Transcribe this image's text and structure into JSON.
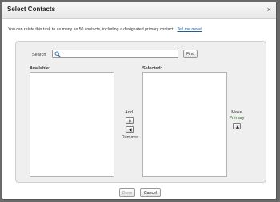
{
  "dialog": {
    "title": "Select Contacts",
    "close_glyph": "×",
    "intro_text": "You can relate this task to as many as 50 contacts, including a designated primary contact.",
    "tell_me_more": "Tell me more!"
  },
  "search": {
    "label": "Search",
    "value": "",
    "find_label": "Find",
    "icon": "search-icon"
  },
  "available": {
    "label": "Available:",
    "items": []
  },
  "selected": {
    "label": "Selected:",
    "items": []
  },
  "transfer": {
    "add_label": "Add",
    "remove_label": "Remove",
    "add_icon": "arrow-right-icon",
    "remove_icon": "arrow-left-icon"
  },
  "primary": {
    "make_label": "Make",
    "primary_label": "Primary",
    "icon": "move-top-icon",
    "accent_color": "#2b6a2b"
  },
  "footer": {
    "done_label": "Done",
    "cancel_label": "Cancel"
  }
}
